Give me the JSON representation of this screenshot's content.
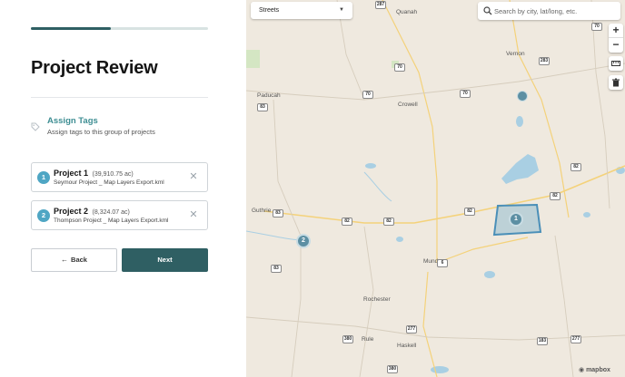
{
  "wizard": {
    "progress_fraction": 0.45,
    "title": "Project Review",
    "step": {
      "title": "Assign Tags",
      "description": "Assign tags to this group of projects"
    },
    "projects": [
      {
        "number": "1",
        "name": "Project 1",
        "acres": "(39,910.75 ac)",
        "file": "Seymour Project _ Map Layers Export.kml"
      },
      {
        "number": "2",
        "name": "Project 2",
        "acres": "(8,324.07 ac)",
        "file": "Thompson Project _ Map Layers Export.kml"
      }
    ],
    "buttons": {
      "back": "Back",
      "next": "Next"
    }
  },
  "map": {
    "style_select": "Streets",
    "search_placeholder": "Search by city, lat/long, etc.",
    "zoom_in": "+",
    "zoom_out": "−",
    "places": [
      "Quanah",
      "Vernon",
      "Paducah",
      "Crowell",
      "Guthrie",
      "Munday",
      "Rochester",
      "Rule",
      "Haskell"
    ],
    "shields": [
      "287",
      "70",
      "70",
      "283",
      "83",
      "70",
      "70",
      "82",
      "83",
      "82",
      "82",
      "82",
      "82",
      "6",
      "83",
      "277",
      "380",
      "380",
      "183",
      "277"
    ],
    "clusters": [
      "1",
      "2"
    ],
    "attribution": "mapbox"
  }
}
